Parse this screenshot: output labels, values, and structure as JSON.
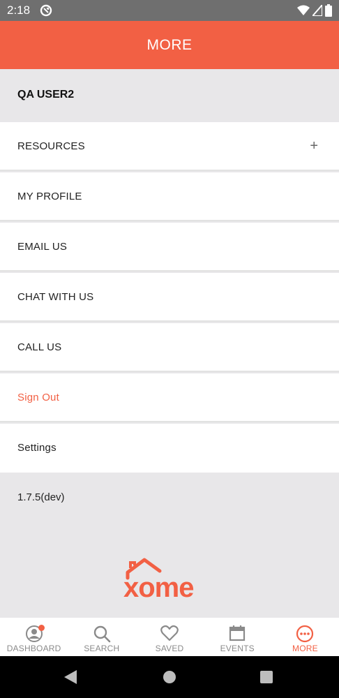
{
  "status_bar": {
    "time": "2:18"
  },
  "app_bar": {
    "title": "MORE"
  },
  "user": {
    "name": "QA USER2"
  },
  "menu": {
    "resources": "RESOURCES",
    "resources_expand": "+",
    "my_profile": "MY PROFILE",
    "email_us": "EMAIL US",
    "chat_with_us": "CHAT WITH US",
    "call_us": "CALL US",
    "sign_out": "Sign Out",
    "settings": "Settings"
  },
  "footer": {
    "version": "1.7.5(dev)",
    "logo_text": "xome"
  },
  "bottom_nav": {
    "dashboard": "DASHBOARD",
    "search": "SEARCH",
    "saved": "SAVED",
    "events": "EVENTS",
    "more": "MORE",
    "active": "more"
  },
  "colors": {
    "brand": "#f26044",
    "inactive": "#8a8a8a"
  }
}
